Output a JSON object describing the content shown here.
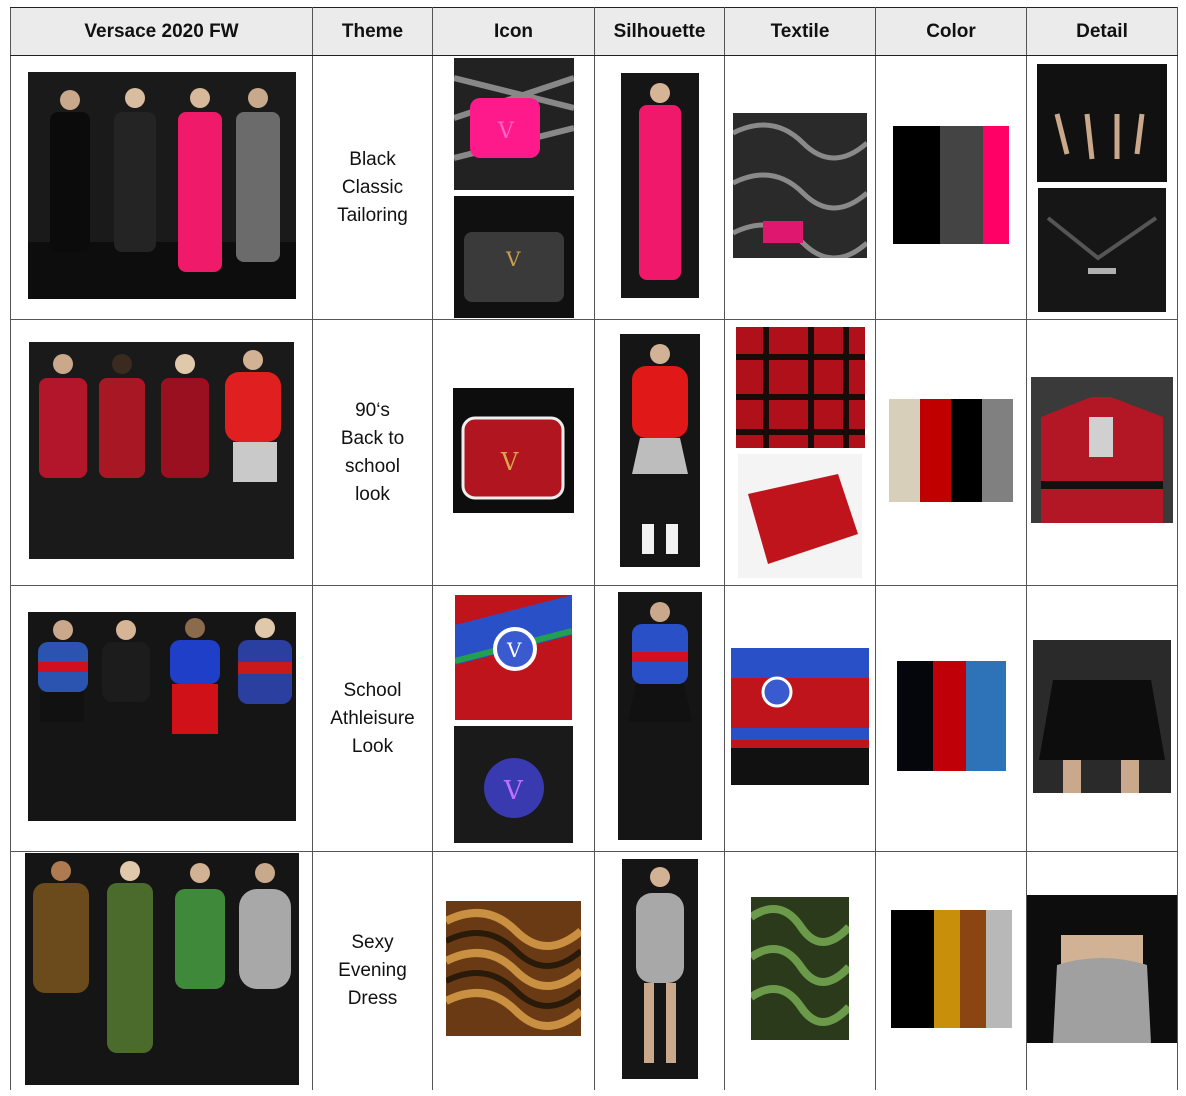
{
  "header": {
    "col1": "Versace 2020 FW",
    "col2": "Theme",
    "col3": "Icon",
    "col4": "Silhouette",
    "col5": "Textile",
    "col6": "Color",
    "col7": "Detail"
  },
  "rows": [
    {
      "theme": [
        "Black",
        "Classic",
        "Tailoring"
      ],
      "colors": [
        "#000000",
        "#444444",
        "#ff0066"
      ]
    },
    {
      "theme": [
        "90‘s",
        "Back to",
        "school",
        "look"
      ],
      "colors": [
        "#d8cfbb",
        "#c00000",
        "#000000",
        "#808080"
      ]
    },
    {
      "theme": [
        "School",
        "Athleisure",
        "Look"
      ],
      "colors": [
        "#05060c",
        "#c00008",
        "#2e73b8"
      ]
    },
    {
      "theme": [
        "Sexy",
        "Evening",
        "Dress"
      ],
      "colors": [
        "#000000",
        "#c8900a",
        "#8a4512",
        "#b8b8b8"
      ]
    }
  ]
}
